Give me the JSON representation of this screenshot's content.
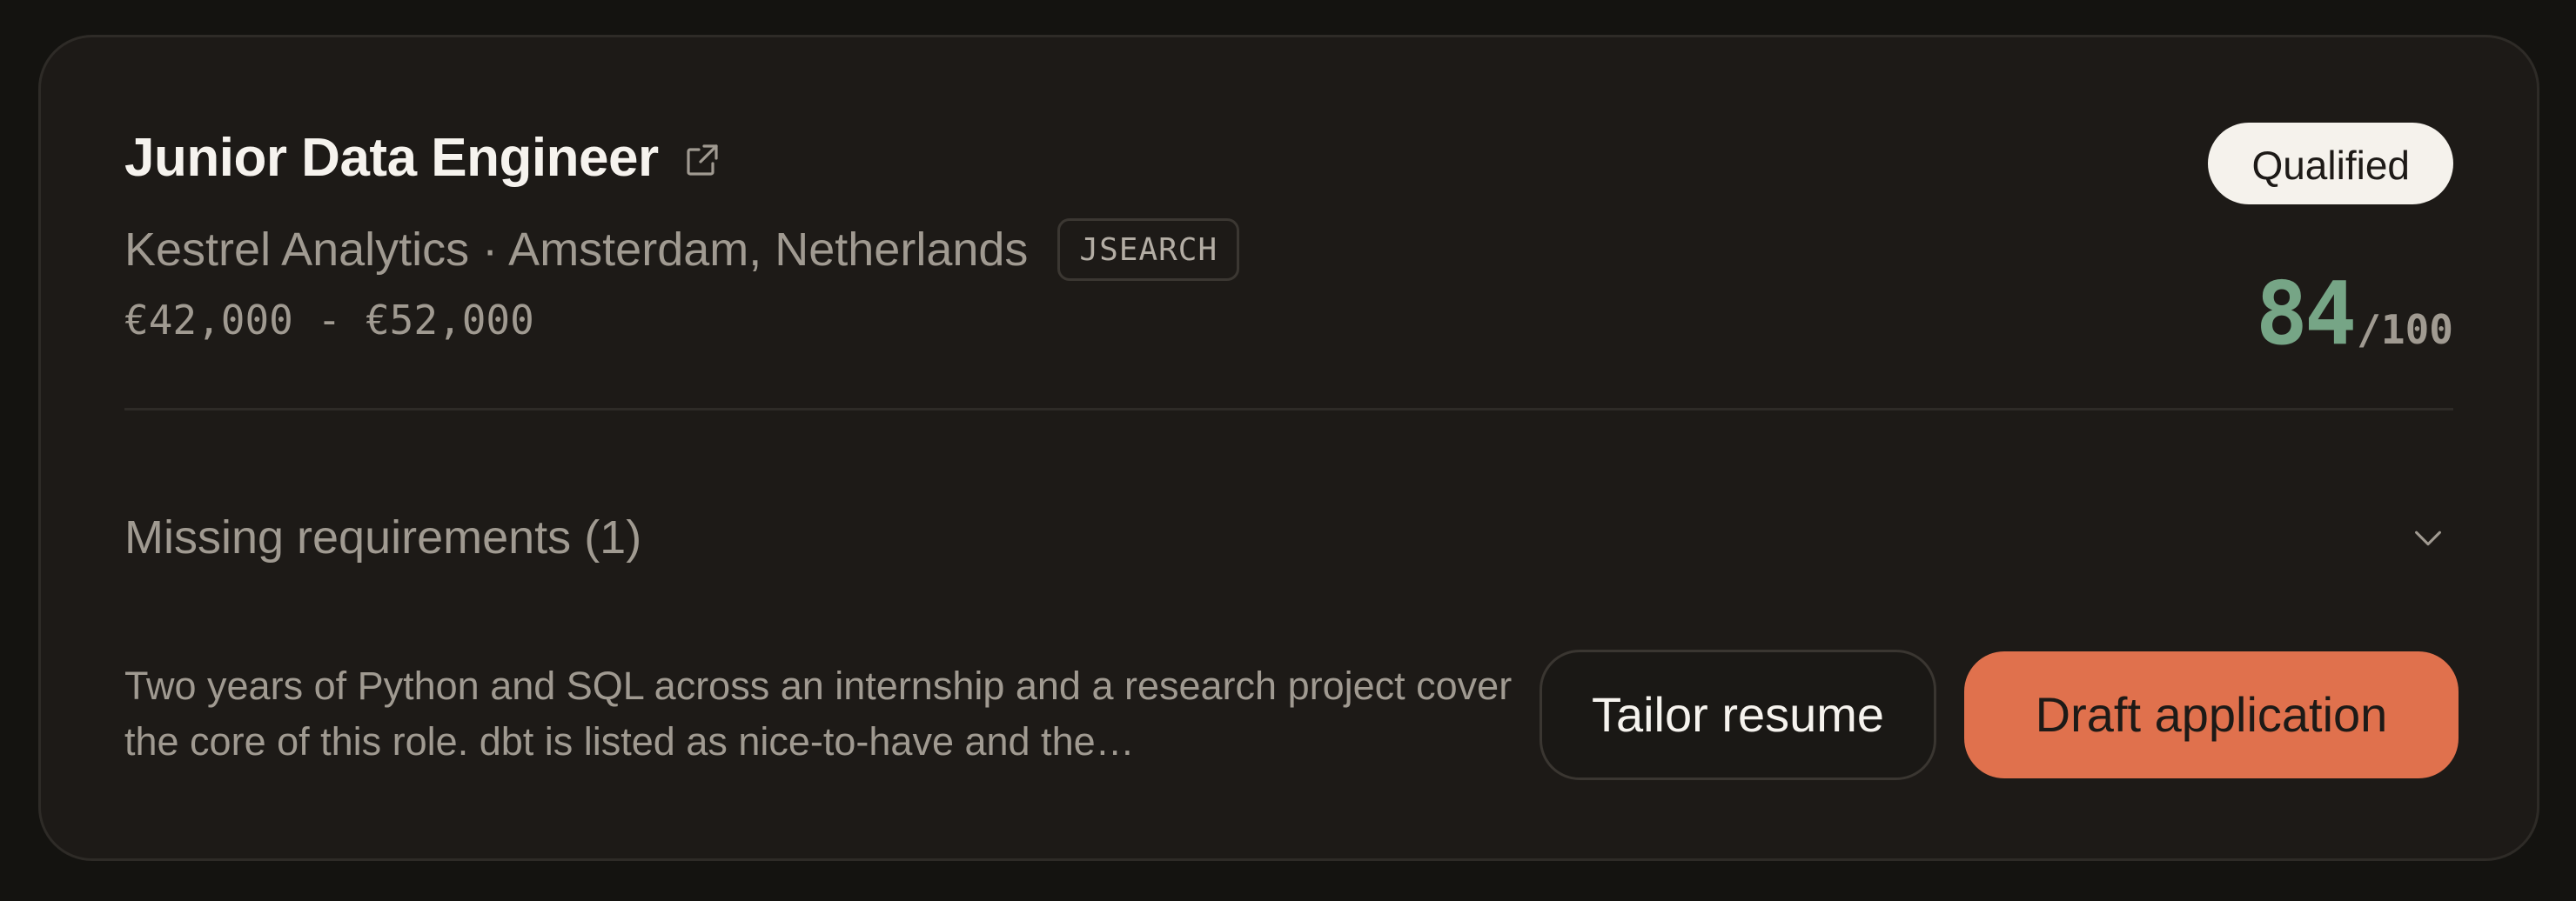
{
  "job": {
    "title": "Junior Data Engineer",
    "company_location": "Kestrel Analytics · Amsterdam, Netherlands",
    "source": "JSEARCH",
    "salary": "€42,000 - €52,000",
    "status": "Qualified",
    "score": "84",
    "score_max": "/100"
  },
  "missing": {
    "label": "Missing requirements (1)"
  },
  "summary": "Two years of Python and SQL across an internship and a research project cover the core of this role. dbt is listed as nice-to-have and the…",
  "actions": {
    "tailor_label": "Tailor resume",
    "draft_label": "Draft application"
  },
  "colors": {
    "accent": "#e0714d",
    "score": "#76a586",
    "card_bg": "#1d1a17",
    "page_bg": "#141310"
  },
  "icons": {
    "external_link": "external-link-icon",
    "expand": "chevron-down-icon"
  }
}
